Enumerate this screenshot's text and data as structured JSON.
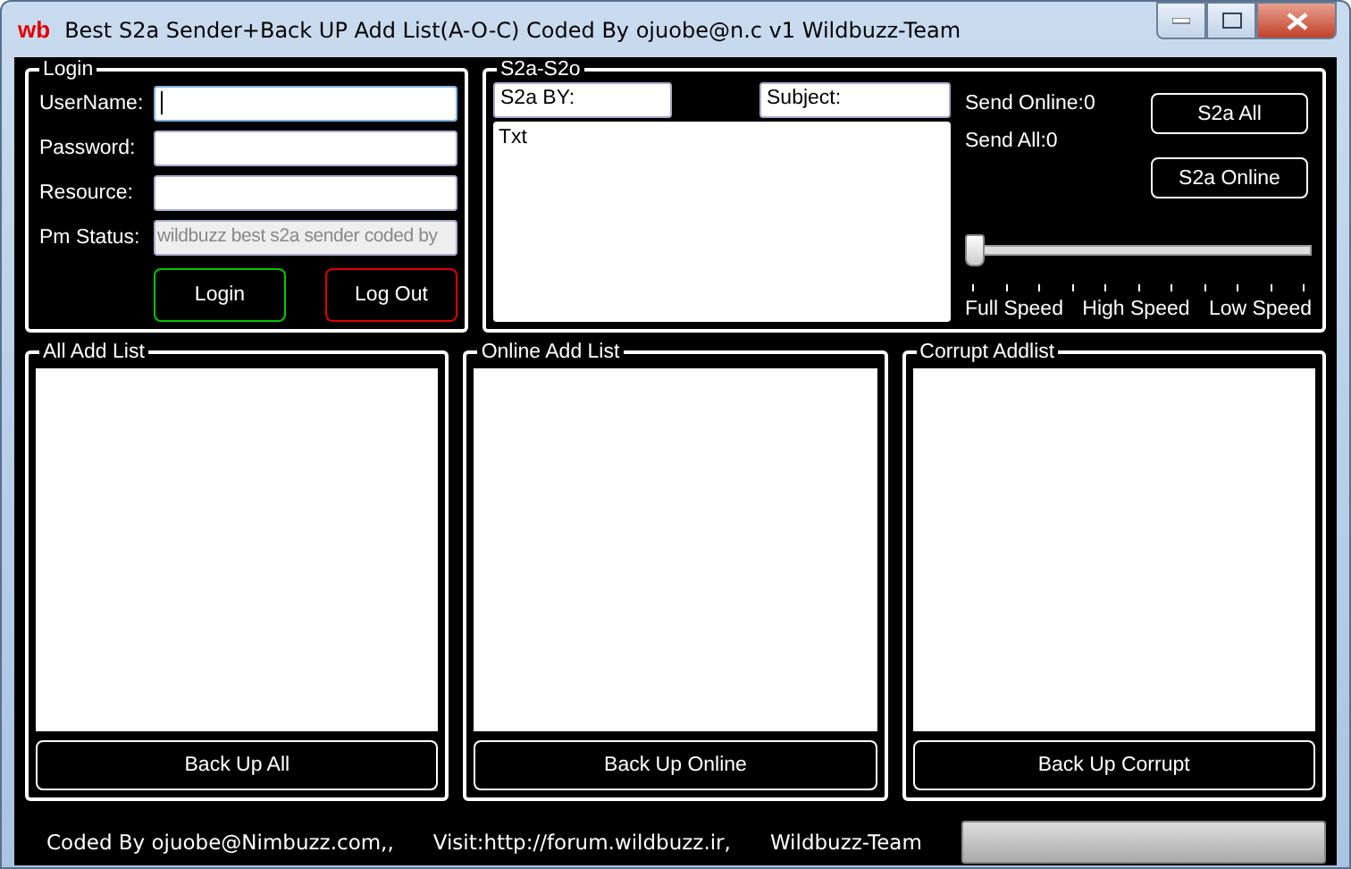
{
  "window": {
    "logo": "wb",
    "title": "Best S2a Sender+Back UP Add List(A-O-C) Coded By ojuobe@n.c v1  Wildbuzz-Team"
  },
  "login": {
    "title": "Login",
    "fields": [
      {
        "label": "UserName:",
        "focused": true,
        "disabled": false
      },
      {
        "label": "Password:",
        "focused": false,
        "disabled": false
      },
      {
        "label": "Resource:",
        "focused": false,
        "disabled": false
      },
      {
        "label": "Pm Status:",
        "value": "wildbuzz best s2a sender coded by",
        "focused": false,
        "disabled": true
      }
    ],
    "buttons": [
      {
        "label": "Login",
        "color": "#00c800"
      },
      {
        "label": "Log Out",
        "color": "#e00000"
      }
    ]
  },
  "s2a": {
    "title": "S2a-S2o",
    "by": "S2a BY:",
    "subject": "Subject:",
    "text": "Txt",
    "send_online": "Send Online:0",
    "send_all": "Send All:0",
    "buttons": [
      "S2a All",
      "S2a Online"
    ],
    "speed": {
      "level": 0,
      "labels": [
        "Full Speed",
        "High Speed",
        "Low Speed"
      ]
    }
  },
  "lists": [
    {
      "title": "All Add List",
      "button": "Back Up All"
    },
    {
      "title": "Online Add List",
      "button": "Back Up Online"
    },
    {
      "title": "Corrupt Addlist",
      "button": "Back Up Corrupt"
    }
  ],
  "status_bar": {
    "texts": [
      "Coded By ojuobe@Nimbuzz.com,,",
      "Visit:http://forum.wildbuzz.ir,",
      "Wildbuzz-Team"
    ],
    "progress": {
      "level": 0
    }
  }
}
